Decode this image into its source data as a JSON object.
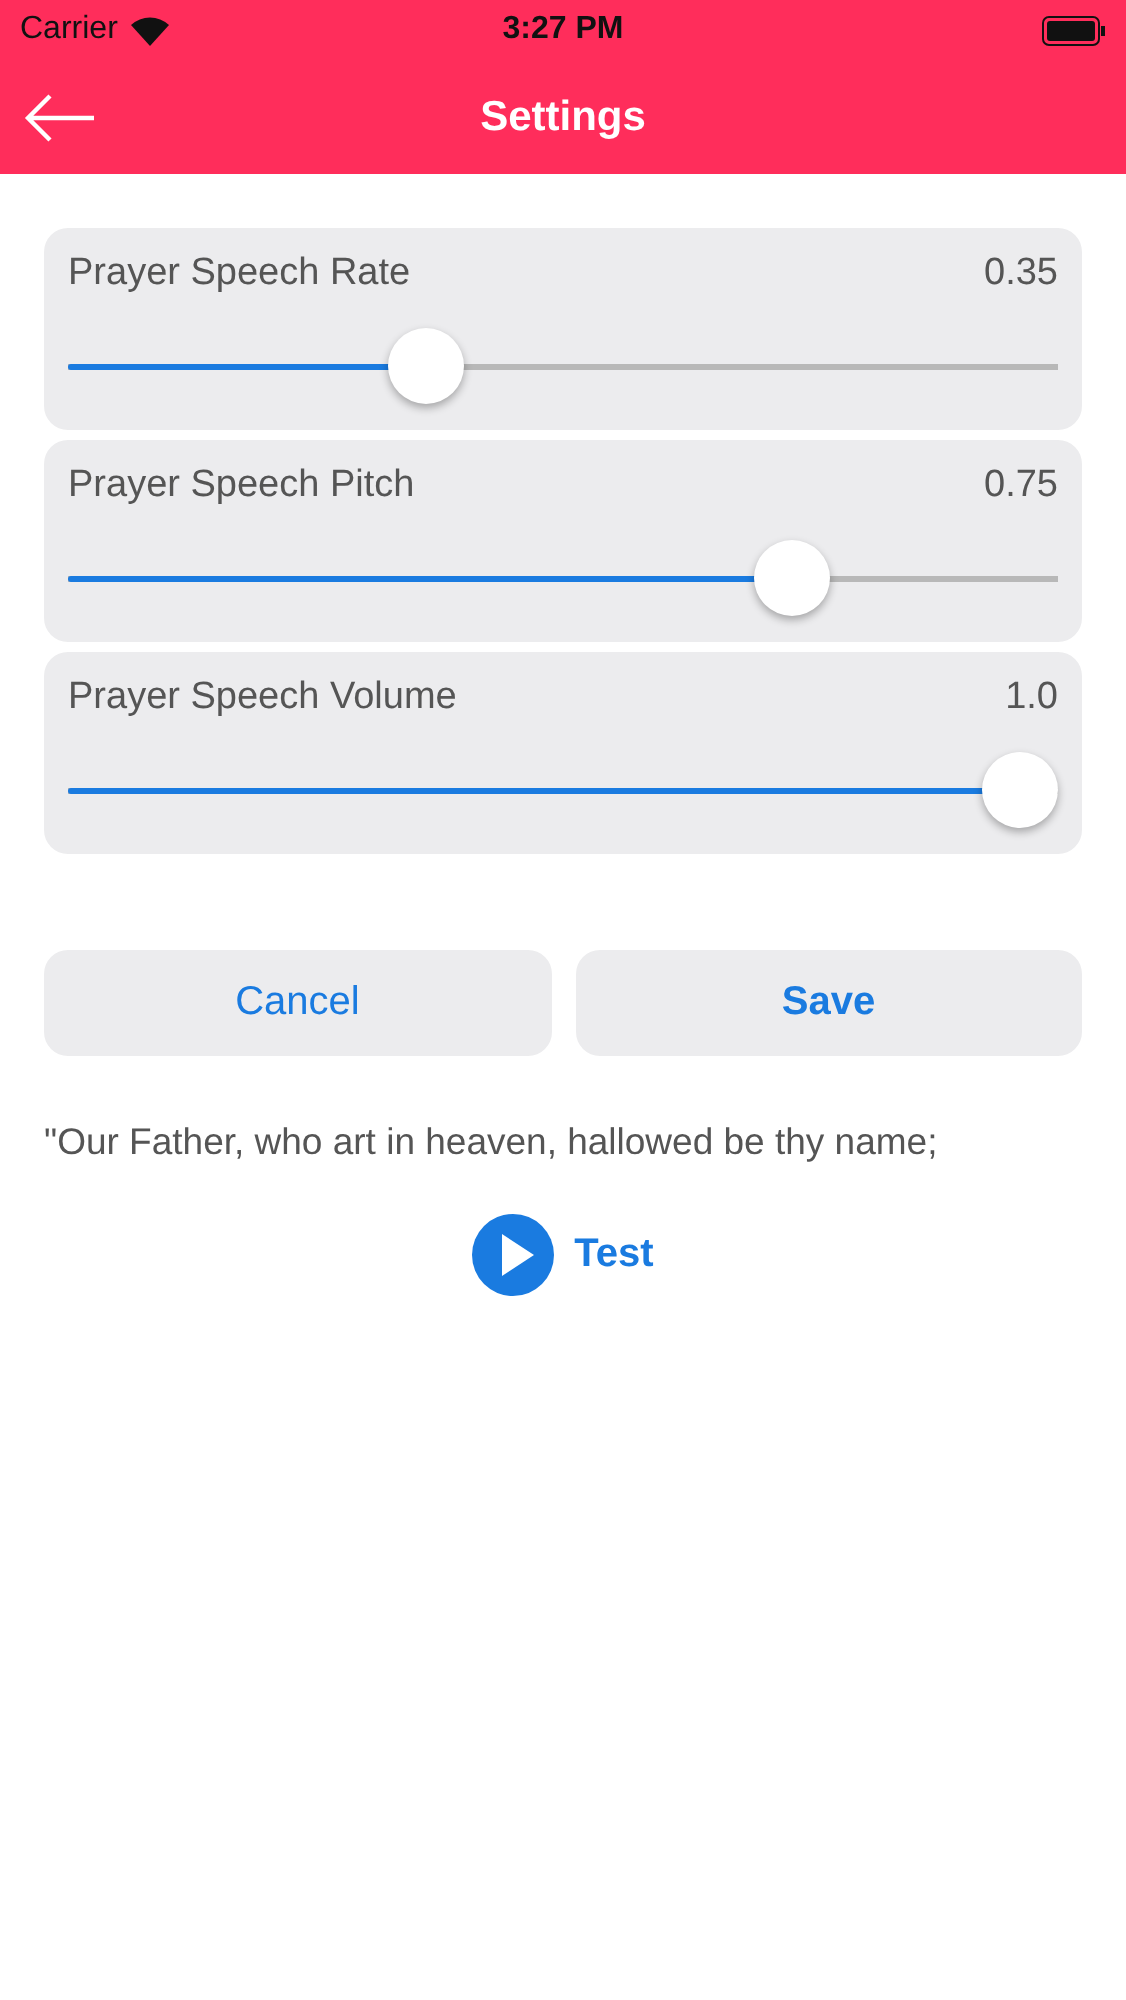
{
  "status_bar": {
    "carrier": "Carrier",
    "time": "3:27 PM"
  },
  "nav": {
    "title": "Settings"
  },
  "sliders": [
    {
      "label": "Prayer Speech Rate",
      "reading": "0.35",
      "level": 0.35
    },
    {
      "label": "Prayer Speech Pitch",
      "reading": "0.75",
      "level": 0.75
    },
    {
      "label": "Prayer Speech Volume",
      "reading": "1.0",
      "level": 1.0
    }
  ],
  "buttons": [
    {
      "label": "Cancel",
      "kind": "secondary"
    },
    {
      "label": "Save",
      "kind": "primary"
    }
  ],
  "sample_text": "\"Our Father, who art in heaven, hallowed be thy name;",
  "test_button": {
    "label": "Test"
  }
}
